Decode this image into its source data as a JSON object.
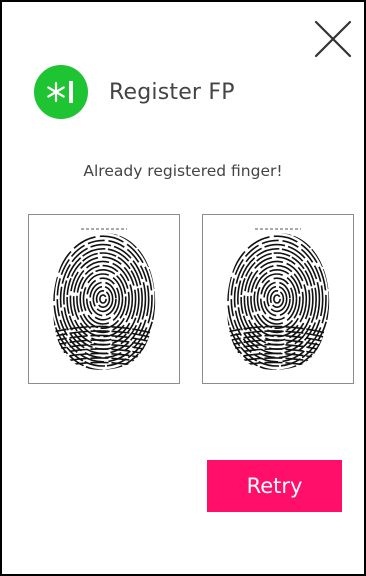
{
  "header": {
    "title": "Register FP",
    "app_icon": "fingerprint-asterisk-icon",
    "app_icon_color": "#1fc432"
  },
  "close_icon": "close-icon",
  "message": "Already registered finger!",
  "fingerprints": {
    "left_image": "fingerprint-image",
    "right_image": "fingerprint-image"
  },
  "retry": {
    "label": "Retry",
    "color": "#ff0f6a"
  }
}
